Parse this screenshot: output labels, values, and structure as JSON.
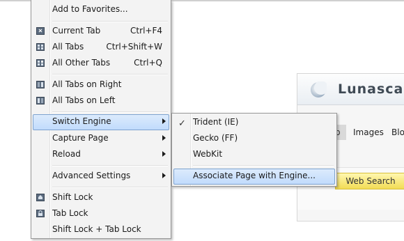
{
  "background_page": {
    "brand": "Lunasca",
    "tab_web_fragment": "b",
    "tabs": [
      "Images",
      "Blo"
    ],
    "search_button": "Web Search"
  },
  "main_menu": {
    "add_favorites": "Add to Favorites...",
    "current_tab": "Current Tab",
    "current_tab_shortcut": "Ctrl+F4",
    "all_tabs": "All Tabs",
    "all_tabs_shortcut": "Ctrl+Shift+W",
    "all_other_tabs": "All Other Tabs",
    "all_other_tabs_shortcut": "Ctrl+Q",
    "all_tabs_right": "All Tabs on Right",
    "all_tabs_left": "All Tabs on Left",
    "switch_engine": "Switch Engine",
    "capture_page": "Capture Page",
    "reload": "Reload",
    "advanced_settings": "Advanced Settings",
    "shift_lock": "Shift Lock",
    "tab_lock": "Tab Lock",
    "shift_tab_lock": "Shift Lock + Tab Lock"
  },
  "sub_menu": {
    "trident": "Trident (IE)",
    "gecko": "Gecko (FF)",
    "webkit": "WebKit",
    "associate": "Associate Page with Engine...",
    "checked_item": "Trident (IE)",
    "check_glyph": "✓"
  },
  "icons": {
    "close_tab": "close-tab-icon",
    "tabs_grid": "tabs-icon",
    "other_tabs": "other-tabs-icon",
    "lock": "lock-icon"
  },
  "colors": {
    "highlight_top": "#dcebfc",
    "highlight_bottom": "#c1dbfc",
    "highlight_border": "#7da2ce",
    "search_button": "#f2dc55"
  }
}
